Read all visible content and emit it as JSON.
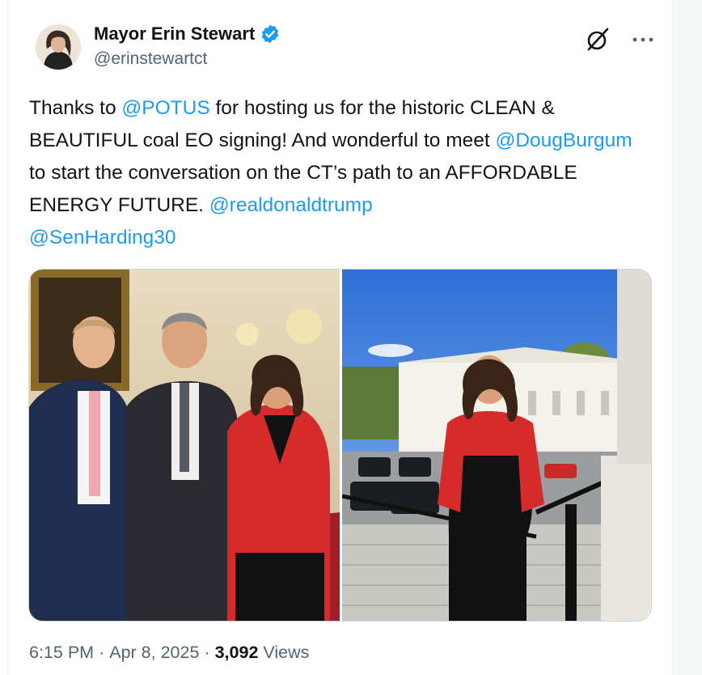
{
  "author": {
    "display_name": "Mayor Erin Stewart",
    "handle": "@erinstewartct",
    "verified": true,
    "avatar_icon": "profile-photo"
  },
  "icons": {
    "grok": "grok-icon",
    "more": "more-options-icon",
    "verified": "verified-badge-icon"
  },
  "tweet": {
    "segments": [
      {
        "text": "Thanks to ",
        "type": "text"
      },
      {
        "text": "@POTUS",
        "type": "mention"
      },
      {
        "text": " for hosting us for the historic CLEAN & BEAUTIFUL coal EO signing! And wonderful to meet ",
        "type": "text"
      },
      {
        "text": "@DougBurgum",
        "type": "mention"
      },
      {
        "text": " to start the conversation on the CT’s path to an AFFORDABLE ENERGY FUTURE. ",
        "type": "text"
      },
      {
        "text": "@realdonaldtrump",
        "type": "mention"
      },
      {
        "text": " ",
        "type": "text"
      },
      {
        "text": "@SenHarding30",
        "type": "mention"
      }
    ]
  },
  "media": [
    {
      "kind": "photo",
      "subject": "three people posing indoors"
    },
    {
      "kind": "photo",
      "subject": "woman in red blazer on outdoor steps"
    }
  ],
  "meta": {
    "time": "6:15 PM",
    "separator": "·",
    "date": "Apr 8, 2025",
    "views_count": "3,092",
    "views_label": "Views"
  },
  "colors": {
    "accent": "#1d9bf0",
    "text": "#0f1419",
    "muted": "#536471",
    "blazer": "#d62b2b"
  }
}
